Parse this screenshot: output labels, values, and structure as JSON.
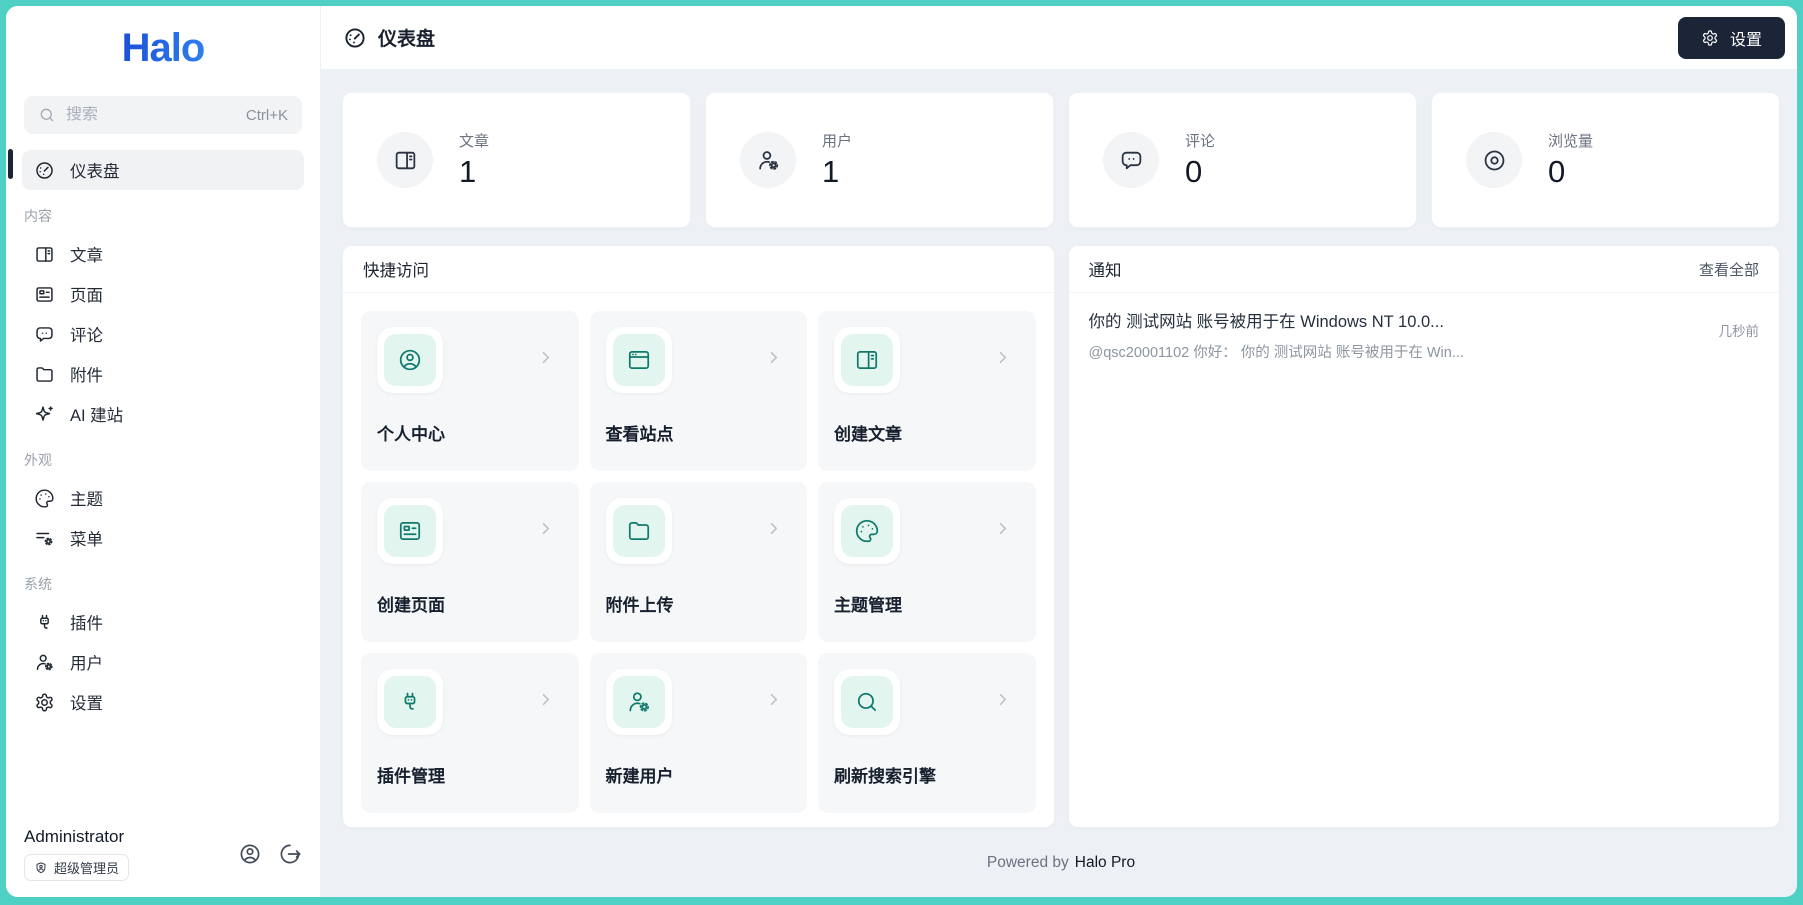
{
  "app": {
    "logo_text": "Halo",
    "frame_color": "#4ed1c4",
    "accent_dark": "#1b2537",
    "teal_icon_color": "#0f7a6c"
  },
  "sidebar": {
    "search": {
      "placeholder": "搜索",
      "shortcut": "Ctrl+K",
      "icon": "search-icon"
    },
    "dashboard": {
      "label": "仪表盘",
      "icon": "gauge-icon"
    },
    "sections": [
      {
        "label": "内容",
        "items": [
          {
            "label": "文章",
            "icon": "posts-icon"
          },
          {
            "label": "页面",
            "icon": "pages-icon"
          },
          {
            "label": "评论",
            "icon": "comment-icon"
          },
          {
            "label": "附件",
            "icon": "folder-icon"
          },
          {
            "label": "AI 建站",
            "icon": "sparkles-icon"
          }
        ]
      },
      {
        "label": "外观",
        "items": [
          {
            "label": "主题",
            "icon": "palette-icon"
          },
          {
            "label": "菜单",
            "icon": "menu-gear-icon"
          }
        ]
      },
      {
        "label": "系统",
        "items": [
          {
            "label": "插件",
            "icon": "plug-icon"
          },
          {
            "label": "用户",
            "icon": "user-gear-icon"
          },
          {
            "label": "设置",
            "icon": "gear-icon"
          }
        ]
      }
    ],
    "user": {
      "name": "Administrator",
      "role_badge": "超级管理员",
      "badge_icon": "user-shield-icon",
      "profile_icon": "user-circle-icon",
      "logout_icon": "logout-icon"
    }
  },
  "header": {
    "title": "仪表盘",
    "title_icon": "gauge-icon",
    "settings_button": {
      "label": "设置",
      "icon": "gear-icon"
    }
  },
  "stats": [
    {
      "label": "文章",
      "value": "1",
      "icon": "posts-icon"
    },
    {
      "label": "用户",
      "value": "1",
      "icon": "user-gear-icon"
    },
    {
      "label": "评论",
      "value": "0",
      "icon": "comment-icon"
    },
    {
      "label": "浏览量",
      "value": "0",
      "icon": "eye-icon"
    }
  ],
  "quick_access": {
    "title": "快捷访问",
    "tiles": [
      {
        "label": "个人中心",
        "icon": "user-circle-icon"
      },
      {
        "label": "查看站点",
        "icon": "browser-icon"
      },
      {
        "label": "创建文章",
        "icon": "posts-icon"
      },
      {
        "label": "创建页面",
        "icon": "pages-icon"
      },
      {
        "label": "附件上传",
        "icon": "folder-icon"
      },
      {
        "label": "主题管理",
        "icon": "palette-icon"
      },
      {
        "label": "插件管理",
        "icon": "plug-icon"
      },
      {
        "label": "新建用户",
        "icon": "user-gear-icon"
      },
      {
        "label": "刷新搜索引擎",
        "icon": "search-icon"
      }
    ]
  },
  "notifications": {
    "title": "通知",
    "view_all_label": "查看全部",
    "items": [
      {
        "title": "你的 测试网站 账号被用于在 Windows NT 10.0...",
        "summary": "@qsc20001102 你好： 你的 测试网站 账号被用于在 Win...",
        "time": "几秒前"
      }
    ]
  },
  "footer": {
    "powered_by": "Powered by",
    "brand": "Halo Pro"
  }
}
